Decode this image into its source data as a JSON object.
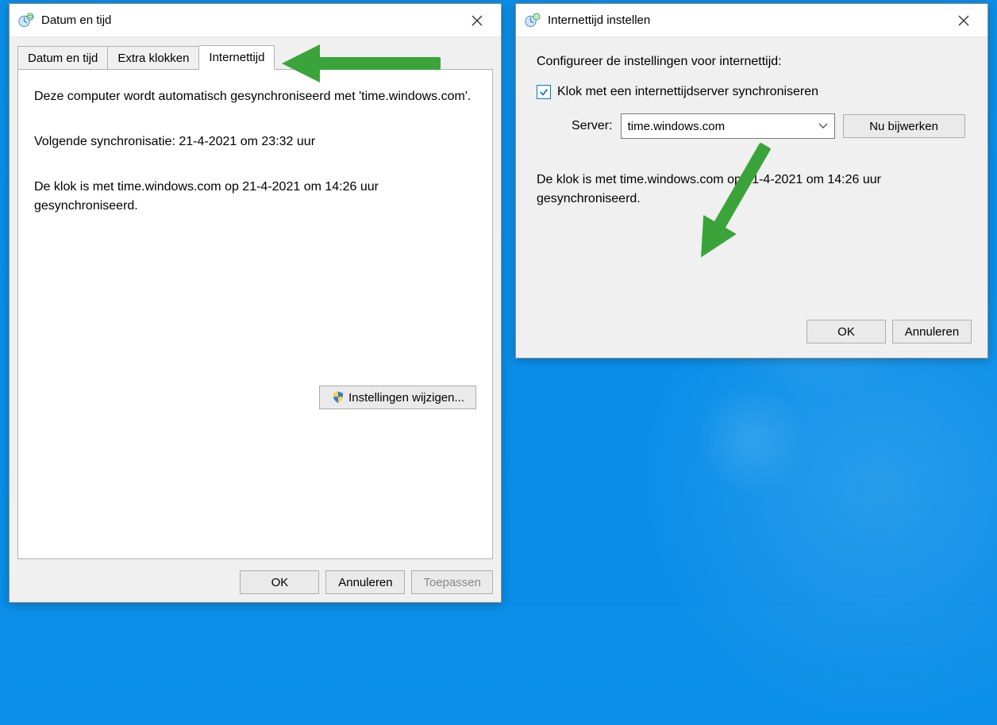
{
  "left": {
    "title": "Datum en tijd",
    "tabs": [
      "Datum en tijd",
      "Extra klokken",
      "Internettijd"
    ],
    "active_tab": 2,
    "sync_text": "Deze computer wordt automatisch gesynchroniseerd met 'time.windows.com'.",
    "next_sync": "Volgende synchronisatie: 21-4-2021 om 23:32 uur",
    "last_sync": "De klok is met time.windows.com op 21-4-2021 om 14:26 uur gesynchroniseerd.",
    "change_settings_label": "Instellingen wijzigen...",
    "ok_label": "OK",
    "cancel_label": "Annuleren",
    "apply_label": "Toepassen"
  },
  "right": {
    "title": "Internettijd instellen",
    "intro": "Configureer de instellingen voor internettijd:",
    "checkbox_label": "Klok met een internettijdserver synchroniseren",
    "checkbox_checked": true,
    "server_label": "Server:",
    "server_value": "time.windows.com",
    "update_now_label": "Nu bijwerken",
    "status": "De klok is met time.windows.com op 21-4-2021 om 14:26 uur gesynchroniseerd.",
    "ok_label": "OK",
    "cancel_label": "Annuleren"
  },
  "colors": {
    "accent": "#0078d7",
    "arrow": "#3aa43a"
  }
}
